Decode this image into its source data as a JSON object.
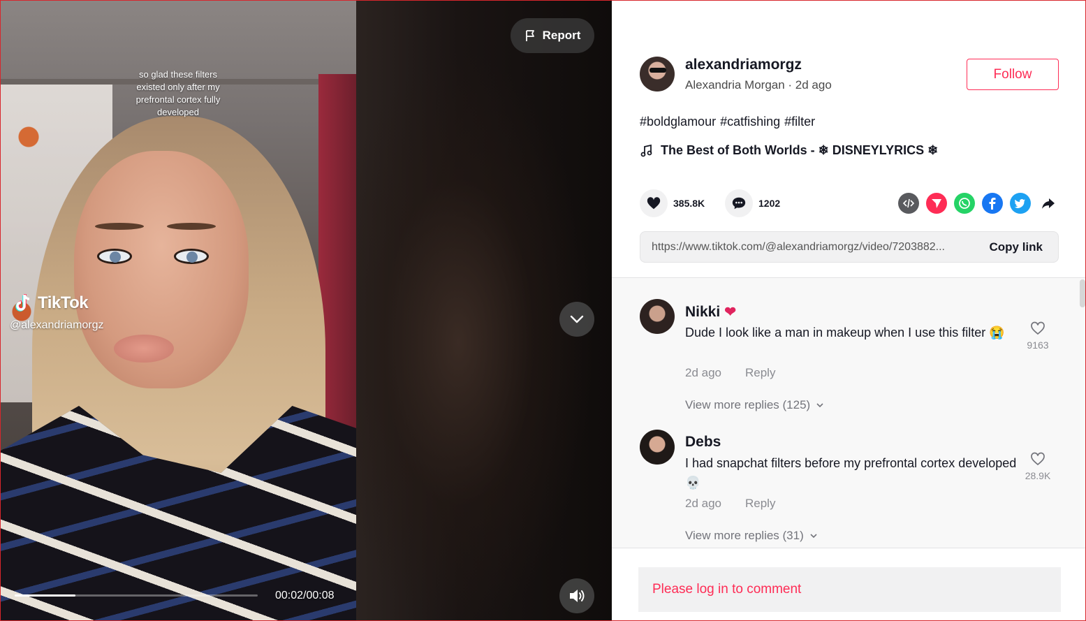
{
  "video": {
    "caption_overlay": "so glad these filters existed only after my prefrontal cortex fully developed",
    "watermark_brand": "TikTok",
    "watermark_handle": "@alexandriamorgz",
    "time_current": "00:02",
    "time_total": "00:08",
    "time_display": "00:02/00:08",
    "progress_fraction": 0.25,
    "report_label": "Report"
  },
  "author": {
    "username": "alexandriamorgz",
    "meta": "Alexandria Morgan · 2d ago",
    "follow_label": "Follow"
  },
  "description": {
    "hashtags": [
      "#boldglamour",
      "#catfishing",
      "#filter"
    ],
    "music": "The Best of Both Worlds - ❄ DISNEYLYRICS ❄"
  },
  "actions": {
    "likes": "385.8K",
    "comments": "1202",
    "share_icons": [
      "embed-icon",
      "send-to-friends-icon",
      "whatsapp-icon",
      "facebook-icon",
      "twitter-icon",
      "share-arrow-icon"
    ]
  },
  "link": {
    "url": "https://www.tiktok.com/@alexandriamorgz/video/7203882...",
    "copy_label": "Copy link"
  },
  "comments": [
    {
      "name": "Nikki",
      "name_emoji": "❤",
      "text": "Dude I look like a man in makeup when I use this filter 😭",
      "time": "2d ago",
      "reply_label": "Reply",
      "likes": "9163",
      "view_more": "View more replies (125)"
    },
    {
      "name": "Debs",
      "text": "I had snapchat filters before my prefrontal cortex developed💀",
      "time": "2d ago",
      "reply_label": "Reply",
      "likes": "28.9K",
      "view_more": "View more replies (31)"
    }
  ],
  "login_prompt": "Please log in to comment",
  "colors": {
    "brand_red": "#fe2c55",
    "text_primary": "#161823",
    "text_secondary": "#8a8b91"
  }
}
